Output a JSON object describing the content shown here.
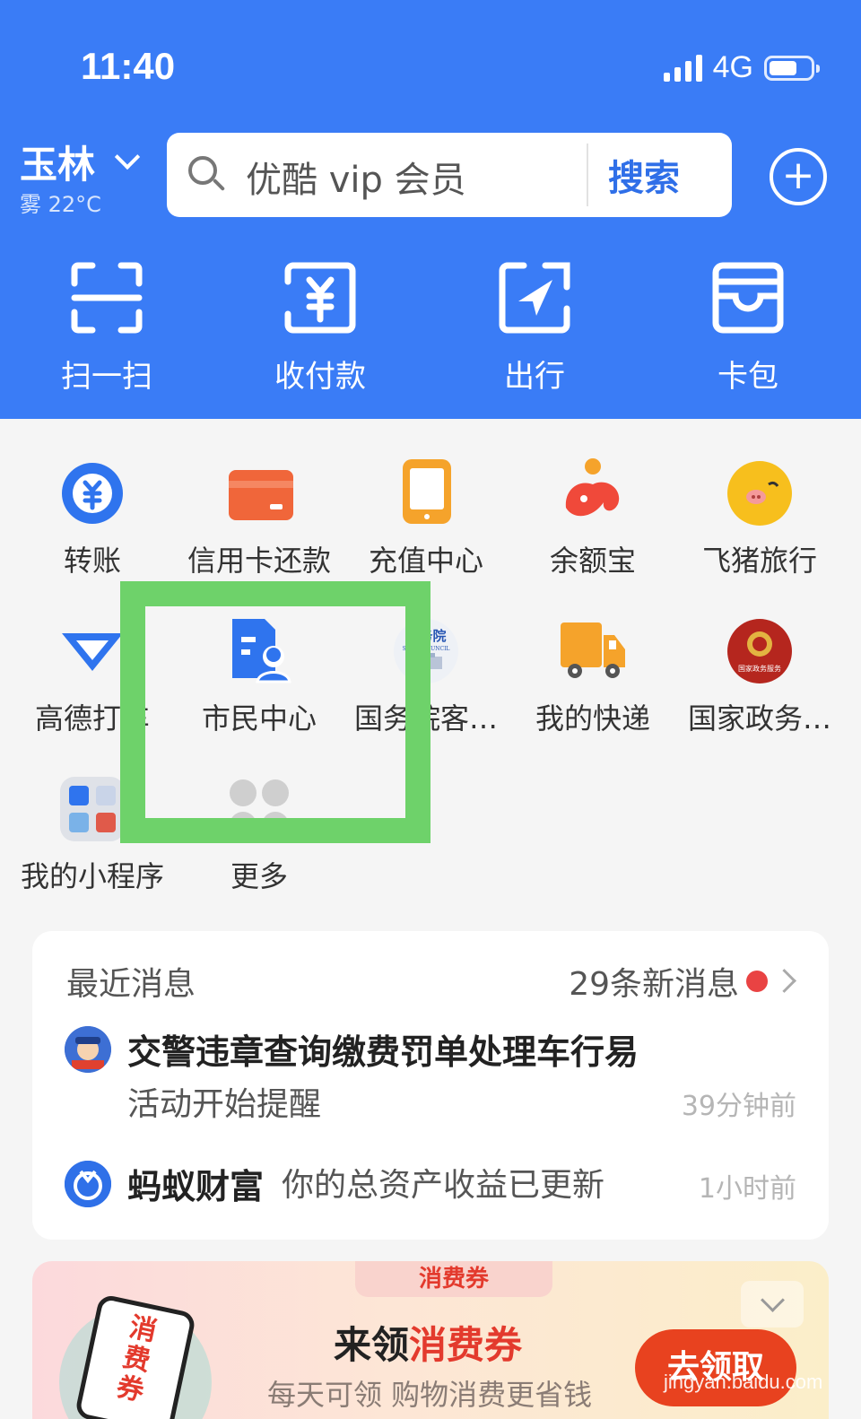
{
  "status": {
    "time": "11:40",
    "network": "4G"
  },
  "header": {
    "city": "玉林",
    "weather": "雾 22°C",
    "search_placeholder": "优酷 vip 会员",
    "search_button": "搜索"
  },
  "main_actions": [
    {
      "label": "扫一扫",
      "icon": "scan-icon"
    },
    {
      "label": "收付款",
      "icon": "pay-receive-icon"
    },
    {
      "label": "出行",
      "icon": "travel-icon"
    },
    {
      "label": "卡包",
      "icon": "card-wallet-icon"
    }
  ],
  "grid": [
    {
      "label": "转账",
      "icon": "transfer-icon"
    },
    {
      "label": "信用卡还款",
      "icon": "credit-card-icon"
    },
    {
      "label": "充值中心",
      "icon": "recharge-icon"
    },
    {
      "label": "余额宝",
      "icon": "yuebao-icon"
    },
    {
      "label": "飞猪旅行",
      "icon": "fliggy-icon"
    },
    {
      "label": "高德打车",
      "icon": "amap-icon"
    },
    {
      "label": "市民中心",
      "icon": "citizen-center-icon"
    },
    {
      "label": "国务院客…",
      "icon": "state-council-icon",
      "icon_text": "国务院",
      "icon_sub": "STATE COUNCIL"
    },
    {
      "label": "我的快递",
      "icon": "express-icon"
    },
    {
      "label": "国家政务…",
      "icon": "gov-service-icon",
      "icon_text": "国家政务服务"
    },
    {
      "label": "我的小程序",
      "icon": "mini-programs-icon"
    },
    {
      "label": "更多",
      "icon": "more-icon"
    }
  ],
  "messages": {
    "title": "最近消息",
    "new_count": "29条新消息",
    "items": [
      {
        "title": "交警违章查询缴费罚单处理车行易",
        "subtitle": "活动开始提醒",
        "time": "39分钟前"
      },
      {
        "source": "蚂蚁财富",
        "text": "你的总资产收益已更新",
        "time": "1小时前"
      }
    ]
  },
  "banner": {
    "tab": "消费券",
    "title_prefix": "来领",
    "title_highlight": "消费券",
    "subtitle": "每天可领 购物消费更省钱",
    "phone_text": "消费券",
    "button": "去领取"
  },
  "watermark": "jingyan.baidu.com",
  "colors": {
    "brand_blue": "#3a7cf6",
    "highlight_green": "#6ed26a",
    "alert_red": "#e94343"
  }
}
